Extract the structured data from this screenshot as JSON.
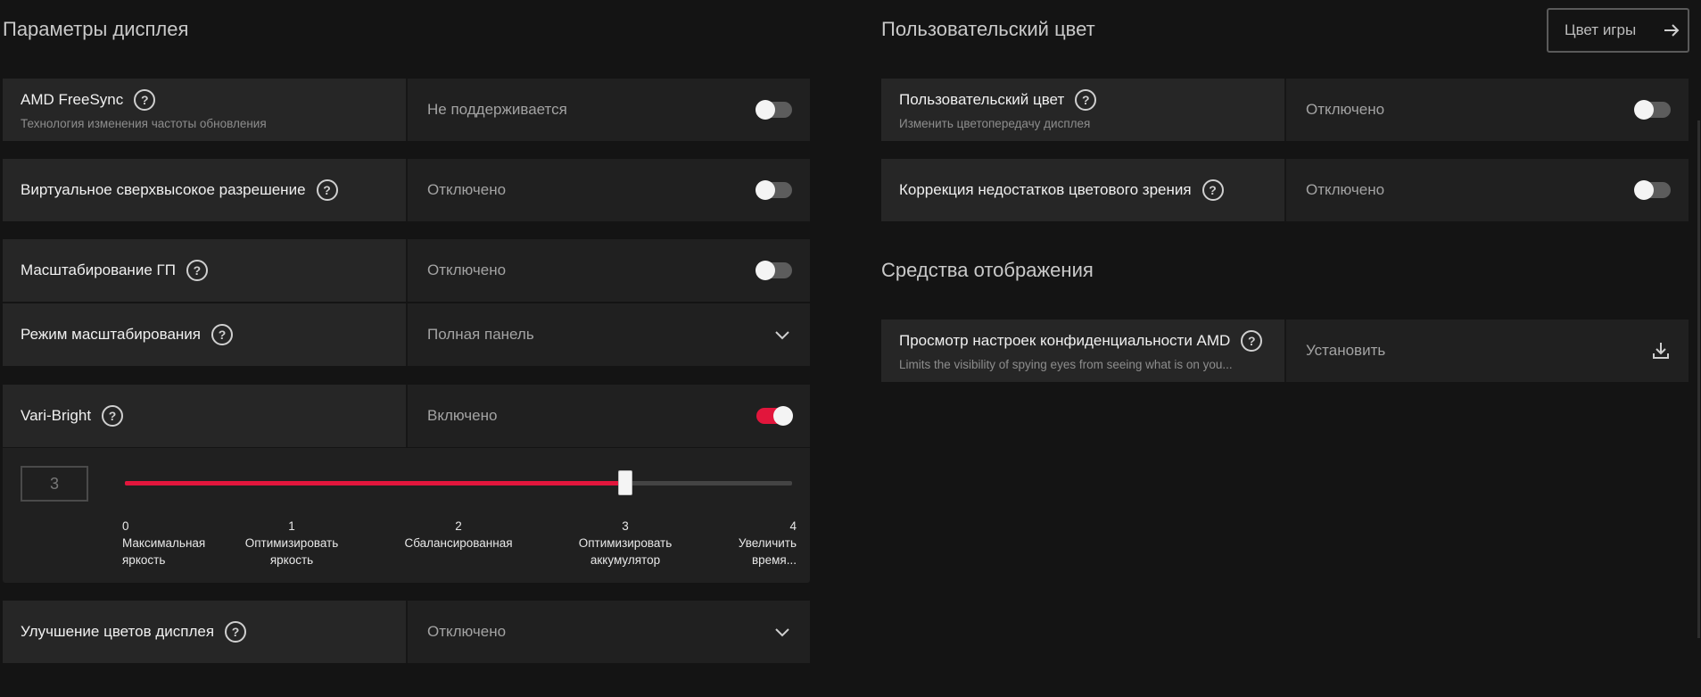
{
  "display_params": {
    "title": "Параметры дисплея",
    "freesync": {
      "label": "AMD FreeSync",
      "sub": "Технология изменения частоты обновления",
      "value": "Не поддерживается",
      "on": false
    },
    "vsr": {
      "label": "Виртуальное сверхвысокое разрешение",
      "value": "Отключено",
      "on": false
    },
    "gpu_scaling": {
      "label": "Масштабирование ГП",
      "value": "Отключено",
      "on": false
    },
    "scaling_mode": {
      "label": "Режим масштабирования",
      "value": "Полная панель"
    },
    "vari_bright": {
      "label": "Vari-Bright",
      "value": "Включено",
      "on": true,
      "level": "3",
      "level_fraction": 0.75,
      "ticks": [
        {
          "num": "0",
          "l1": "Максимальная",
          "l2": "яркость"
        },
        {
          "num": "1",
          "l1": "Оптимизировать",
          "l2": "яркость"
        },
        {
          "num": "2",
          "l1": "Сбалансированная",
          "l2": ""
        },
        {
          "num": "3",
          "l1": "Оптимизировать",
          "l2": "аккумулятор"
        },
        {
          "num": "4",
          "l1": "Увеличить",
          "l2": "время..."
        }
      ]
    },
    "color_enhance": {
      "label": "Улучшение цветов дисплея",
      "value": "Отключено"
    }
  },
  "custom_color": {
    "title": "Пользовательский цвет",
    "game_color_button": "Цвет игры",
    "custom": {
      "label": "Пользовательский цвет",
      "sub": "Изменить цветопередачу дисплея",
      "value": "Отключено",
      "on": false
    },
    "cvd": {
      "label": "Коррекция недостатков цветового зрения",
      "value": "Отключено",
      "on": false
    }
  },
  "display_tools": {
    "title": "Средства отображения",
    "privacy": {
      "label": "Просмотр настроек конфиденциальности AMD",
      "sub": "Limits the visibility of spying eyes from seeing what is on you...",
      "value": "Установить"
    }
  },
  "colors": {
    "accent": "#e2163c",
    "background": "#141414",
    "panel": "#222222"
  }
}
